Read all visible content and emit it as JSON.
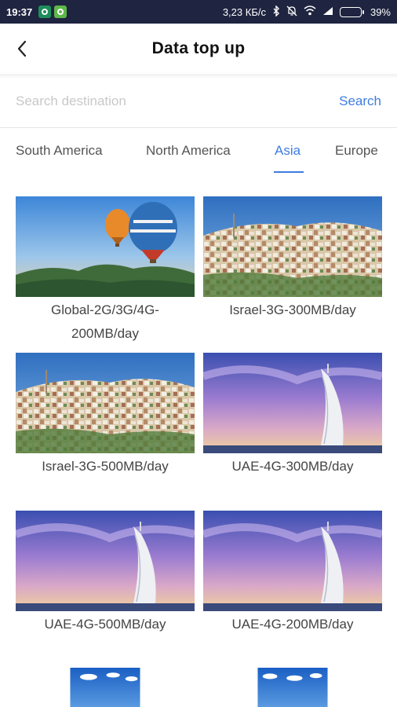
{
  "status": {
    "time": "19:37",
    "network_speed": "3,23 КБ/с",
    "battery": "39%",
    "battery_level": 0.39
  },
  "header": {
    "title": "Data top up"
  },
  "search": {
    "placeholder": "Search destination",
    "button": "Search"
  },
  "tabs": [
    {
      "label": "South America",
      "active": false
    },
    {
      "label": "North America",
      "active": false
    },
    {
      "label": "Asia",
      "active": true
    },
    {
      "label": "Europe",
      "active": false
    }
  ],
  "products": [
    {
      "name": "Global-2G/3G/4G-200MB/day",
      "name_line1": "Global-2G/3G/4G-",
      "name_line2": "200MB/day",
      "image": "balloons"
    },
    {
      "name": "Israel-3G-300MB/day",
      "image": "hillside-town"
    },
    {
      "name": "Israel-3G-500MB/day",
      "image": "hillside-town"
    },
    {
      "name": "UAE-4G-300MB/day",
      "image": "sail-tower"
    },
    {
      "name": "UAE-4G-500MB/day",
      "image": "sail-tower"
    },
    {
      "name": "UAE-4G-200MB/day",
      "image": "sail-tower"
    },
    {
      "name": "",
      "image": "sky-clouds"
    },
    {
      "name": "",
      "image": "sky-clouds"
    }
  ],
  "colors": {
    "accent": "#3e7de0",
    "status_bar": "#1f2440"
  }
}
